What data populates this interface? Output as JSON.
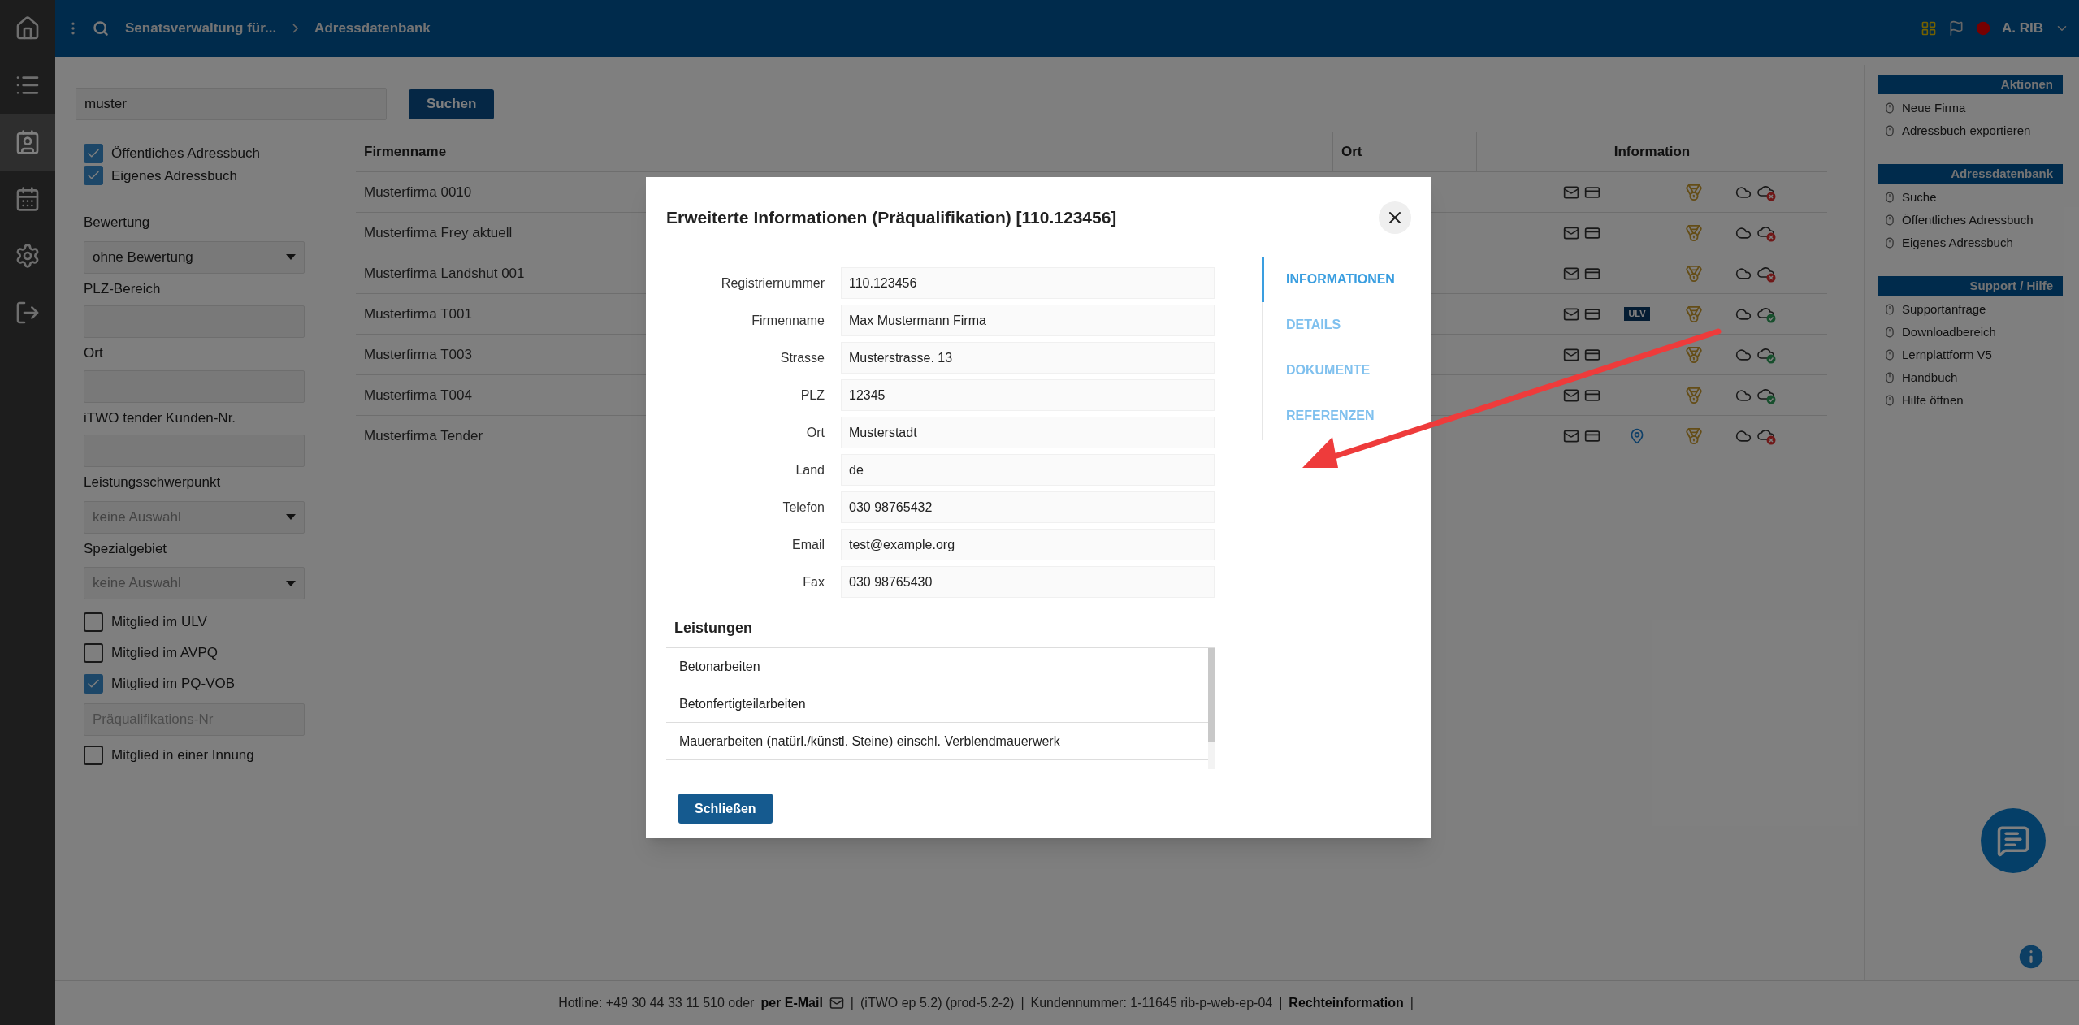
{
  "rail": [
    {
      "kind": "home",
      "selected": false
    },
    {
      "kind": "list",
      "selected": false
    },
    {
      "kind": "addressbook",
      "selected": true
    },
    {
      "kind": "calendar",
      "selected": false
    },
    {
      "kind": "settings",
      "selected": false
    },
    {
      "kind": "logout",
      "selected": false
    }
  ],
  "topbar": {
    "breadcrumb": [
      "Senatsverwaltung für...",
      "Adressdatenbank"
    ],
    "user": "A. RIB"
  },
  "search": {
    "value": "muster",
    "button": "Suchen"
  },
  "address_books": [
    {
      "label": "Öffentliches Adressbuch",
      "checked": true
    },
    {
      "label": "Eigenes Adressbuch",
      "checked": true
    }
  ],
  "filters": [
    {
      "kind": "select",
      "label": "Bewertung",
      "value": "ohne Bewertung"
    },
    {
      "kind": "input",
      "label": "PLZ-Bereich"
    },
    {
      "kind": "input",
      "label": "Ort"
    },
    {
      "kind": "input",
      "label": "iTWO tender Kunden-Nr."
    },
    {
      "kind": "select",
      "label": "Leistungsschwerpunkt",
      "placeholder": "keine Auswahl"
    },
    {
      "kind": "select",
      "label": "Spezialgebiet",
      "placeholder": "keine Auswahl"
    }
  ],
  "memberships": [
    {
      "kind": "checkbox",
      "label": "Mitglied im ULV",
      "checked": false
    },
    {
      "kind": "checkbox",
      "label": "Mitglied im AVPQ",
      "checked": false
    },
    {
      "kind": "checkbox",
      "label": "Mitglied im PQ-VOB",
      "checked": true
    },
    {
      "kind": "input",
      "placeholder": "Präqualifikations-Nr"
    },
    {
      "kind": "checkbox",
      "label": "Mitglied in einer Innung",
      "checked": false
    }
  ],
  "table": {
    "columns": [
      "Firmenname",
      "Ort",
      "Information"
    ],
    "rows": [
      {
        "firmenname": "Musterfirma 0010",
        "location_pin": false,
        "sync_error": true
      },
      {
        "firmenname": "Musterfirma Frey aktuell",
        "location_pin": false,
        "sync_error": true
      },
      {
        "firmenname": "Musterfirma Landshut 001",
        "location_pin": false,
        "sync_error": true
      },
      {
        "firmenname": "Musterfirma T001",
        "badge": "ULV",
        "location_pin": false,
        "sync_error": false
      },
      {
        "firmenname": "Musterfirma T003",
        "location_pin": false,
        "sync_error": false
      },
      {
        "firmenname": "Musterfirma T004",
        "location_pin": false,
        "sync_error": false
      },
      {
        "firmenname": "Musterfirma Tender",
        "location_pin": true,
        "sync_error": true
      }
    ]
  },
  "sidebar": [
    {
      "title": "Aktionen",
      "items": [
        "Neue Firma",
        "Adressbuch exportieren"
      ]
    },
    {
      "title": "Adressdatenbank",
      "items": [
        "Suche",
        "Öffentliches Adressbuch",
        "Eigenes Adressbuch"
      ]
    },
    {
      "title": "Support / Hilfe",
      "items": [
        "Supportanfrage",
        "Downloadbereich",
        "Lernplattform V5",
        "Handbuch",
        "Hilfe öffnen"
      ]
    }
  ],
  "footer": {
    "hotline": "Hotline: +49 30 44 33 11 510 oder",
    "email_link": "per E-Mail",
    "separator": "|",
    "version": "(iTWO ep 5.2) (prod-5.2-2)",
    "customer": "Kundennummer: 1-11645 rib-p-web-ep-04",
    "rights_link": "Rechteinformation"
  },
  "modal": {
    "title": "Erweiterte Informationen (Präqualifikation) [110.123456]",
    "fields": [
      {
        "label": "Registriernummer",
        "value": "110.123456"
      },
      {
        "label": "Firmenname",
        "value": "Max Mustermann Firma"
      },
      {
        "label": "Strasse",
        "value": "Musterstrasse. 13"
      },
      {
        "label": "PLZ",
        "value": "12345"
      },
      {
        "label": "Ort",
        "value": "Musterstadt"
      },
      {
        "label": "Land",
        "value": "de"
      },
      {
        "label": "Telefon",
        "value": "030 98765432"
      },
      {
        "label": "Email",
        "value": "test@example.org"
      },
      {
        "label": "Fax",
        "value": "030 98765430"
      }
    ],
    "tabs": [
      {
        "label": "INFORMATIONEN",
        "selected": true
      },
      {
        "label": "DETAILS",
        "selected": false
      },
      {
        "label": "DOKUMENTE",
        "selected": false
      },
      {
        "label": "REFERENZEN",
        "selected": false
      }
    ],
    "services_title": "Leistungen",
    "services": [
      "Betonarbeiten",
      "Betonfertigteilarbeiten",
      "Mauerarbeiten (natürl./künstl. Steine) einschl. Verblendmauerwerk"
    ],
    "close_button": "Schließen"
  }
}
